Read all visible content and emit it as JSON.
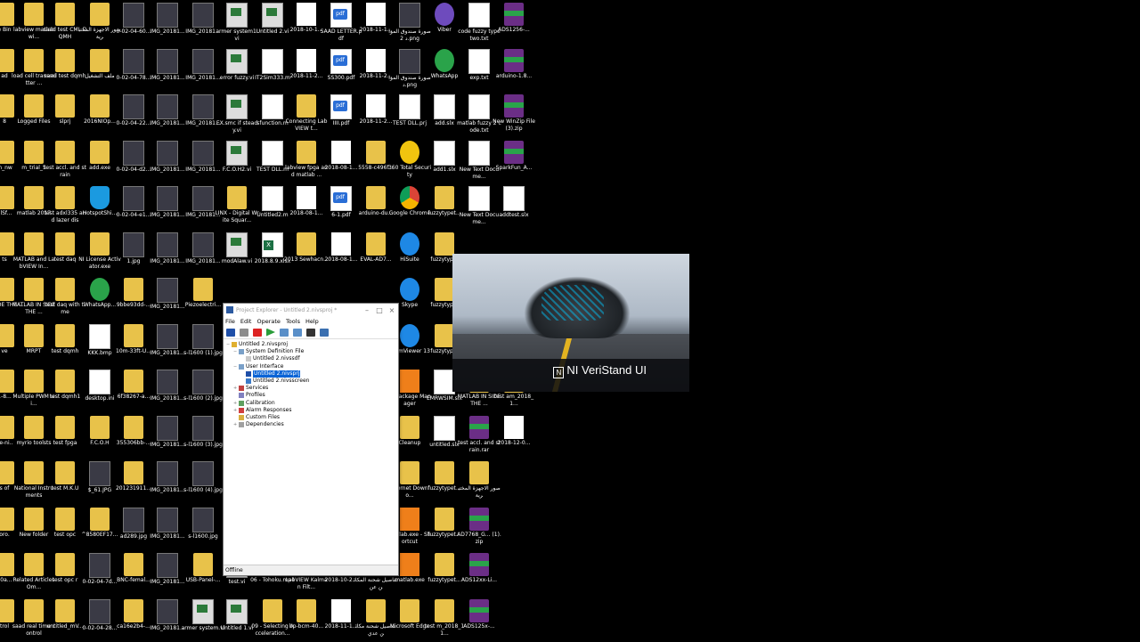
{
  "desktop": {
    "columns": [
      [
        "e Bin",
        "ad",
        "8",
        "m_nw",
        "nlSf...",
        "ts",
        "IN SIDE THE ...",
        "ve",
        "1-8...",
        "de-ni..",
        "s of",
        "oro.",
        "80a...",
        "trol"
      ],
      [
        "labview matlab wi...",
        "load cell transmitter ...",
        "Logged Files",
        "m_trial_5",
        "matlab 2017",
        "MATLAB and LabVIEW In...",
        "MATLAB IN SIDE THE ...",
        "MRPT",
        "Multiple PWM wi...",
        "myrio toolsts",
        "National Instruments",
        "New folder",
        "Related Articles Om...",
        "saad real time control"
      ],
      [
        "saad test CML DQMH",
        "saad test dqmh",
        "slprj",
        "test accl. and strain",
        "test adxl335 and lazer dis",
        "test daq",
        "test daq with time",
        "test dqmh",
        "test dqmh1",
        "test fpga",
        "test M.K.U",
        "test opc",
        "test opc r",
        "untitled_mV..."
      ],
      [
        "صور الاجهزة المختبرية",
        "ملف التشغيل",
        "2016NIOp...",
        "add.exe",
        "HotspotShi...",
        "NI License Activator.exe",
        "WhatsApp...",
        "KKK.bmp",
        "desktop.ini",
        "F.C.O.H",
        "$_61.JPG",
        "^8580EF17...",
        "0-02-04-7d...",
        "0-02-04-28..."
      ],
      [
        "0-02-04-60...",
        "0-02-04-78...",
        "0-02-04-22...",
        "0-02-04-d2...",
        "0-02-04-e1...",
        "1.jpg",
        "9bbe93dd-...",
        "10m-33ft-U...",
        "6f38267-a...",
        "355306bb-...",
        "201231911...",
        "ad289.jpg",
        "BNC-femal...",
        "ca16e2b4-..."
      ],
      [
        "IMG_20181...",
        "IMG_20181...",
        "IMG_20181...",
        "IMG_20181...",
        "IMG_20181...",
        "IMG_20181...",
        "IMG_20181...",
        "IMG_20181...",
        "IMG_20181...",
        "IMG_20181...",
        "IMG_20181...",
        "IMG_20181...",
        "IMG_20181...",
        "IMG_20181..."
      ],
      [
        "IMG_20181...",
        "IMG_20181...",
        "IMG_20181...",
        "IMG_20181...",
        "IMG_20181...",
        "IMG_20181...",
        "Piezoelectri...",
        "s-l1600 (1).jpg",
        "s-l1600 (2).jpg",
        "s-l1600 (3).jpg",
        "s-l1600 (4).jpg",
        "s-l1600.jpg",
        "USB-Panel-...",
        "armer system.vi"
      ],
      [
        "armer system1.vi",
        "error fuzzy.vi",
        "EX.smc if steady.vi",
        "F.C.O.H2.vi",
        "LINX - Digital Write Squar...",
        "modAlaw.vi",
        "",
        "",
        "",
        "",
        "",
        "",
        "test.vi",
        "Untitled 1.vi"
      ],
      [
        "Untitled 2.vi",
        "IT2Sim333.m",
        "sfunction.m",
        "TEST DLL.m",
        "Untitled2.m",
        "2018.8.9.xlsx",
        "",
        "",
        "",
        "",
        "",
        "",
        "06 - Tohoku.mp4",
        "09 - Selecting Acceleration..."
      ],
      [
        "2018-10-1...",
        "2018-11-2...",
        "Connecting LabVIEW t...",
        "labview fpga and matlab ...",
        "2018-08-1...",
        "2013 Sewhacn...",
        "",
        "",
        "",
        "",
        "",
        "",
        "LabVIEW Kalman Filt...",
        "bp-bcm-40..."
      ],
      [
        "SAAD LETTER.pdf",
        "SS300.pdf",
        "IIII.pdf",
        "2018-08-1...",
        "6-1.pdf",
        "2018-08-1...",
        "",
        "",
        "",
        "",
        "",
        "",
        "2018-10-2...",
        "2018-11-1..."
      ],
      [
        "2018-11-1...",
        "2018-11-2...",
        "2018-11-2...",
        "5558-c496f...",
        "arduino-du...",
        "EVAL-AD7...",
        "",
        "",
        "",
        "",
        "",
        "",
        "تفاصيل شحنة المكائن عن",
        "تفاصيل شحنة مكائن عدي"
      ],
      [
        "صورة صندوق المواد 2.png",
        "صورة صندوق المواد.png",
        "TEST DLL.prj",
        "360 Total Security",
        "Google Chrome",
        "HiSuite",
        "Skype",
        "TeamViewer 13",
        "NI Package Manager",
        "Cleanup",
        "Internet Downlo...",
        "matlab.exe - Shortcut",
        "matlab.exe",
        "Microsoft Edge"
      ],
      [
        "Viber",
        "WhatsApp",
        "add.slx",
        "add1.slx",
        "fuzzytypet...",
        "fuzzytyp...",
        "fuzzytyp...",
        "fuzzytyp...",
        "EMRWSIM.slx",
        "untitled.slx",
        "fuzzytypet...",
        "fuzzytypet...",
        "fuzzytypet...",
        "test m_2018_11..."
      ],
      [
        "code fuzzy type two.txt",
        "exp.txt",
        "matlab fuzzy 2 code.txt",
        "New Text Docume...",
        "New Text Docume...",
        "",
        "",
        "",
        "MATLAB IN SIDE THE ...",
        "test accl. and strain.rar",
        "صور الاجهزة المختبرية",
        "AD7768_G... (1).zip",
        "ADS12xx-Li...",
        "ADS125x-..."
      ],
      [
        "ADS1256-...",
        "arduino-1.8...",
        "New WinZip File (3).zip",
        "SparkFun_A...",
        "addtest.slx",
        "",
        "",
        "",
        "test am_2018_1...",
        "2018-12-0...",
        "",
        "",
        "",
        ""
      ]
    ]
  },
  "project_explorer": {
    "title": "Project Explorer - Untitled 2.nivsproj *",
    "menu": [
      "File",
      "Edit",
      "Operate",
      "Tools",
      "Help"
    ],
    "tree": [
      {
        "label": "Untitled 2.nivsproj",
        "depth": 0,
        "exp": "−"
      },
      {
        "label": "System Definition File",
        "depth": 1,
        "exp": "−"
      },
      {
        "label": "Untitled 2.nivssdf",
        "depth": 2,
        "exp": ""
      },
      {
        "label": "User Interface",
        "depth": 1,
        "exp": "−"
      },
      {
        "label": "Untitled 2.nivsprj",
        "depth": 2,
        "exp": "",
        "selected": true
      },
      {
        "label": "Untitled 2.nivsscreen",
        "depth": 2,
        "exp": ""
      },
      {
        "label": "Services",
        "depth": 1,
        "exp": "+"
      },
      {
        "label": "Profiles",
        "depth": 1,
        "exp": ""
      },
      {
        "label": "Calibration",
        "depth": 1,
        "exp": "+"
      },
      {
        "label": "Alarm Responses",
        "depth": 1,
        "exp": "+"
      },
      {
        "label": "Custom Files",
        "depth": 1,
        "exp": ""
      },
      {
        "label": "Dependencies",
        "depth": 1,
        "exp": "+"
      }
    ],
    "status": "Offline"
  },
  "splash": {
    "brand": "NI VeriStand UI",
    "logo": "N"
  }
}
